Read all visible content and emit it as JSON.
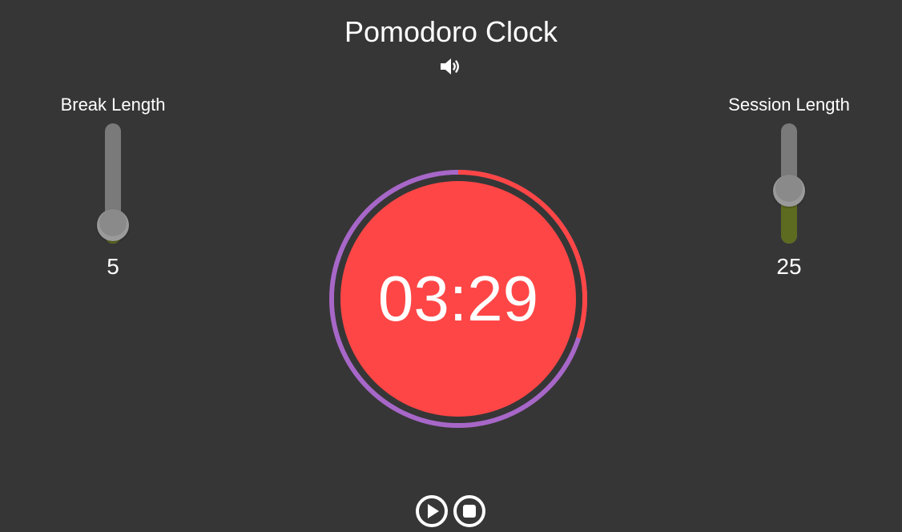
{
  "app": {
    "title": "Pomodoro Clock"
  },
  "sound": {
    "icon": "speaker-volume-icon",
    "enabled": true
  },
  "break_length": {
    "label": "Break Length",
    "value": "5",
    "fill_fraction": 0.1
  },
  "session_length": {
    "label": "Session Length",
    "value": "25",
    "fill_fraction": 0.43
  },
  "timer": {
    "display": "03:29",
    "elapsed_fraction": 0.3
  },
  "controls": {
    "play_icon": "play-circle-icon",
    "stop_icon": "stop-circle-icon"
  },
  "colors": {
    "background": "#363636",
    "clock_face": "#ff4646",
    "elapsed_ring": "#ff4646",
    "remaining_ring": "#a767c8",
    "slider_track": "#7a7a7a",
    "slider_fill": "#5d6b20",
    "slider_thumb": "#8e8e8e",
    "text": "#ffffff"
  }
}
